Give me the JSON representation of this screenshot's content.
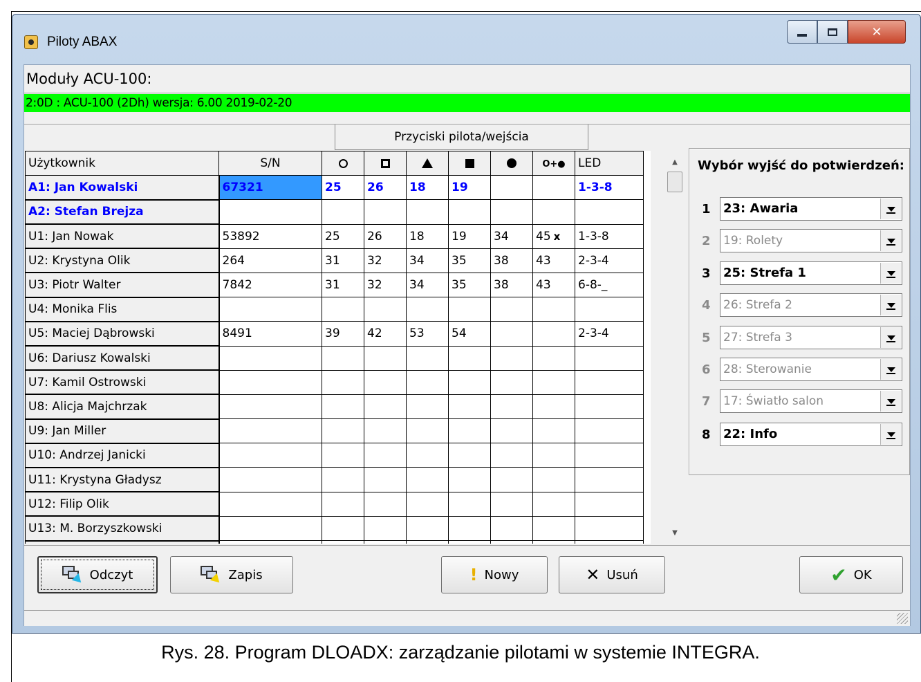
{
  "window": {
    "title": "Piloty ABAX"
  },
  "modules": {
    "heading": "Moduły ACU-100:",
    "selected": "2:0D :  ACU-100   (2Dh) wersja: 6.00 2019-02-20"
  },
  "grid": {
    "group_header": "Przyciski pilota/wejścia",
    "headers": {
      "user": "Użytkownik",
      "sn": "S/N",
      "led": "LED",
      "combo": "O+●"
    },
    "button_icons": [
      "circle-outline-icon",
      "square-outline-icon",
      "triangle-filled-icon",
      "square-filled-icon",
      "circle-filled-icon",
      "circle-plus-circle-icon"
    ],
    "rows": [
      {
        "user": "A1: Jan Kowalski",
        "sn": "67321",
        "b": [
          "25",
          "26",
          "18",
          "19",
          "",
          ""
        ],
        "led": "1-3-8",
        "bold": true,
        "x": ""
      },
      {
        "user": "A2: Stefan Brejza",
        "sn": "",
        "b": [
          "",
          "",
          "",
          "",
          "",
          ""
        ],
        "led": "",
        "bold": true,
        "x": ""
      },
      {
        "user": "U1: Jan Nowak",
        "sn": "53892",
        "b": [
          "25",
          "26",
          "18",
          "19",
          "34",
          "45"
        ],
        "led": "1-3-8",
        "bold": false,
        "x": "x"
      },
      {
        "user": "U2: Krystyna Olik",
        "sn": "264",
        "b": [
          "31",
          "32",
          "34",
          "35",
          "38",
          "43"
        ],
        "led": "2-3-4",
        "bold": false,
        "x": ""
      },
      {
        "user": "U3: Piotr Walter",
        "sn": "7842",
        "b": [
          "31",
          "32",
          "34",
          "35",
          "38",
          "43"
        ],
        "led": "6-8-_",
        "bold": false,
        "x": ""
      },
      {
        "user": "U4: Monika Flis",
        "sn": "",
        "b": [
          "",
          "",
          "",
          "",
          "",
          ""
        ],
        "led": "",
        "bold": false,
        "x": ""
      },
      {
        "user": "U5: Maciej Dąbrowski",
        "sn": "8491",
        "b": [
          "39",
          "42",
          "53",
          "54",
          "",
          ""
        ],
        "led": "2-3-4",
        "bold": false,
        "x": ""
      },
      {
        "user": "U6: Dariusz Kowalski",
        "sn": "",
        "b": [
          "",
          "",
          "",
          "",
          "",
          ""
        ],
        "led": "",
        "bold": false,
        "x": ""
      },
      {
        "user": "U7: Kamil Ostrowski",
        "sn": "",
        "b": [
          "",
          "",
          "",
          "",
          "",
          ""
        ],
        "led": "",
        "bold": false,
        "x": ""
      },
      {
        "user": "U8: Alicja Majchrzak",
        "sn": "",
        "b": [
          "",
          "",
          "",
          "",
          "",
          ""
        ],
        "led": "",
        "bold": false,
        "x": ""
      },
      {
        "user": "U9: Jan Miller",
        "sn": "",
        "b": [
          "",
          "",
          "",
          "",
          "",
          ""
        ],
        "led": "",
        "bold": false,
        "x": ""
      },
      {
        "user": "U10: Andrzej Janicki",
        "sn": "",
        "b": [
          "",
          "",
          "",
          "",
          "",
          ""
        ],
        "led": "",
        "bold": false,
        "x": ""
      },
      {
        "user": "U11: Krystyna Gładysz",
        "sn": "",
        "b": [
          "",
          "",
          "",
          "",
          "",
          ""
        ],
        "led": "",
        "bold": false,
        "x": ""
      },
      {
        "user": "U12: Filip Olik",
        "sn": "",
        "b": [
          "",
          "",
          "",
          "",
          "",
          ""
        ],
        "led": "",
        "bold": false,
        "x": ""
      },
      {
        "user": "U13: M. Borzyszkowski",
        "sn": "",
        "b": [
          "",
          "",
          "",
          "",
          "",
          ""
        ],
        "led": "",
        "bold": false,
        "x": ""
      },
      {
        "user": "",
        "sn": "",
        "b": [
          "",
          "",
          "",
          "",
          "",
          ""
        ],
        "led": "",
        "bold": false,
        "x": ""
      }
    ]
  },
  "outputs": {
    "title": "Wybór wyjść do potwierdzeń:",
    "items": [
      {
        "num": "1",
        "value": "23: Awaria",
        "active": true
      },
      {
        "num": "2",
        "value": "19: Rolety",
        "active": false
      },
      {
        "num": "3",
        "value": "25: Strefa 1",
        "active": true
      },
      {
        "num": "4",
        "value": "26: Strefa 2",
        "active": false
      },
      {
        "num": "5",
        "value": "27: Strefa 3",
        "active": false
      },
      {
        "num": "6",
        "value": "28: Sterowanie",
        "active": false
      },
      {
        "num": "7",
        "value": "17: Światło salon",
        "active": false
      },
      {
        "num": "8",
        "value": "22: Info",
        "active": true
      }
    ]
  },
  "buttons": {
    "read": "Odczyt",
    "write": "Zapis",
    "new": "Nowy",
    "delete": "Usuń",
    "ok": "OK"
  },
  "caption": "Rys. 28. Program DLOADX: zarządzanie pilotami w systemie INTEGRA."
}
